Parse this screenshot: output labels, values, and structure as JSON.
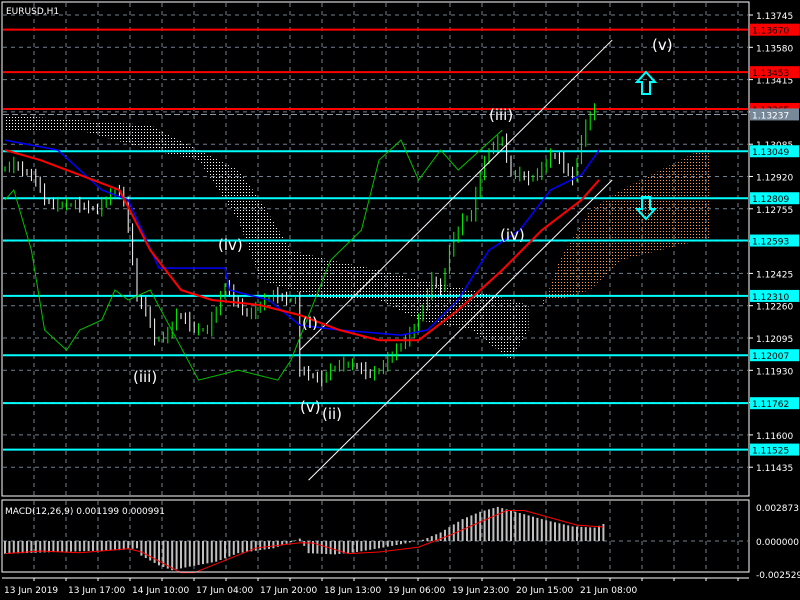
{
  "chart_title": "EURUSD,H1",
  "macd_label": "MACD(12,26,9) 0.001199 0.000991",
  "colors": {
    "background": "#000000",
    "grid": "#708090",
    "up_bar": "#00ff00",
    "down_bar": "#ffffff",
    "red_level": "#ff0000",
    "cyan_level": "#00ffff",
    "ma_red": "#ff0000",
    "ma_blue": "#0000ff",
    "chikou": "#00c000",
    "cloud_bull": "#ff9a40",
    "cloud_bear": "#ffffff",
    "macd_hist": "#c0c0c0",
    "macd_signal": "#ff0000"
  },
  "chart_data": {
    "type": "line",
    "title": "EURUSD,H1",
    "price_axis": {
      "ylim": [
        1.11435,
        1.13745
      ],
      "ticks": [
        "1.13745",
        "1.13580",
        "1.13415",
        "1.13250",
        "1.13085",
        "1.12920",
        "1.12755",
        "1.12590",
        "1.12425",
        "1.12260",
        "1.12095",
        "1.11930",
        "1.11765",
        "1.11600",
        "1.11435"
      ]
    },
    "time_axis": {
      "labels": [
        "13 Jun 2019",
        "13 Jun 17:00",
        "14 Jun 10:00",
        "17 Jun 04:00",
        "17 Jun 20:00",
        "18 Jun 13:00",
        "19 Jun 06:00",
        "19 Jun 23:00",
        "20 Jun 15:00",
        "21 Jun 08:00"
      ]
    },
    "levels_red": [
      "1.13670",
      "1.13453",
      "1.13265"
    ],
    "levels_cyan": [
      "1.13049",
      "1.12809",
      "1.12593",
      "1.12310",
      "1.12007",
      "1.11762",
      "1.11525"
    ],
    "bid_price": "1.13237",
    "price": [
      [
        0,
        1.12953
      ],
      [
        3,
        1.12979
      ],
      [
        8,
        1.12902
      ],
      [
        10,
        1.128
      ],
      [
        12,
        1.12774
      ],
      [
        17,
        1.12774
      ],
      [
        22,
        1.12749
      ],
      [
        26,
        1.12851
      ],
      [
        28,
        1.128
      ],
      [
        30,
        1.12493
      ],
      [
        31,
        1.12289
      ],
      [
        33,
        1.12238
      ],
      [
        35,
        1.12084
      ],
      [
        38,
        1.1211
      ],
      [
        40,
        1.12212
      ],
      [
        42,
        1.12187
      ],
      [
        44,
        1.12136
      ],
      [
        47,
        1.12136
      ],
      [
        49,
        1.12238
      ],
      [
        51,
        1.12365
      ],
      [
        53,
        1.12289
      ],
      [
        56,
        1.12212
      ],
      [
        58,
        1.12238
      ],
      [
        60,
        1.12289
      ],
      [
        62,
        1.12314
      ],
      [
        65,
        1.12289
      ],
      [
        67,
        1.12289
      ],
      [
        68,
        1.11931
      ],
      [
        70,
        1.11905
      ],
      [
        73,
        1.1188
      ],
      [
        75,
        1.11931
      ],
      [
        77,
        1.11957
      ],
      [
        80,
        1.11957
      ],
      [
        82,
        1.11931
      ],
      [
        84,
        1.11905
      ],
      [
        86,
        1.11931
      ],
      [
        89,
        1.12008
      ],
      [
        91,
        1.12059
      ],
      [
        93,
        1.1211
      ],
      [
        95,
        1.12187
      ],
      [
        98,
        1.12391
      ],
      [
        100,
        1.1234
      ],
      [
        102,
        1.12544
      ],
      [
        105,
        1.12698
      ],
      [
        107,
        1.12723
      ],
      [
        109,
        1.12928
      ],
      [
        111,
        1.13055
      ],
      [
        114,
        1.13106
      ],
      [
        116,
        1.12928
      ],
      [
        118,
        1.12928
      ],
      [
        120,
        1.12902
      ],
      [
        123,
        1.12953
      ],
      [
        125,
        1.1303
      ],
      [
        127,
        1.13004
      ],
      [
        130,
        1.12902
      ],
      [
        132,
        1.13106
      ],
      [
        134,
        1.13234
      ],
      [
        135,
        1.1326
      ]
    ],
    "ma_red": [
      [
        0,
        1.13055
      ],
      [
        8,
        1.13004
      ],
      [
        17,
        1.12928
      ],
      [
        26,
        1.12851
      ],
      [
        33,
        1.12544
      ],
      [
        40,
        1.1234
      ],
      [
        47,
        1.12289
      ],
      [
        58,
        1.12263
      ],
      [
        67,
        1.12212
      ],
      [
        76,
        1.12136
      ],
      [
        85,
        1.12084
      ],
      [
        94,
        1.12084
      ],
      [
        103,
        1.12238
      ],
      [
        113,
        1.12442
      ],
      [
        122,
        1.12646
      ],
      [
        131,
        1.128
      ],
      [
        135,
        1.12902
      ]
    ],
    "ma_blue": [
      [
        0,
        1.13106
      ],
      [
        12,
        1.13055
      ],
      [
        22,
        1.12851
      ],
      [
        28,
        1.128
      ],
      [
        35,
        1.12452
      ],
      [
        50,
        1.12452
      ],
      [
        51,
        1.1234
      ],
      [
        60,
        1.12289
      ],
      [
        67,
        1.12161
      ],
      [
        76,
        1.12136
      ],
      [
        90,
        1.1211
      ],
      [
        96,
        1.12136
      ],
      [
        103,
        1.12289
      ],
      [
        110,
        1.12544
      ],
      [
        117,
        1.12646
      ],
      [
        124,
        1.12851
      ],
      [
        131,
        1.12928
      ],
      [
        135,
        1.13055
      ]
    ],
    "chikou": [
      [
        0,
        1.128
      ],
      [
        2,
        1.12851
      ],
      [
        6,
        1.12544
      ],
      [
        9,
        1.12136
      ],
      [
        14,
        1.12033
      ],
      [
        17,
        1.12136
      ],
      [
        22,
        1.12187
      ],
      [
        25,
        1.1234
      ],
      [
        28,
        1.12289
      ],
      [
        33,
        1.1234
      ],
      [
        44,
        1.1188
      ],
      [
        53,
        1.11931
      ],
      [
        62,
        1.1188
      ],
      [
        65,
        1.11982
      ],
      [
        74,
        1.12493
      ],
      [
        81,
        1.12646
      ],
      [
        85,
        1.13004
      ],
      [
        90,
        1.13106
      ],
      [
        94,
        1.12902
      ],
      [
        99,
        1.13055
      ],
      [
        103,
        1.12953
      ],
      [
        108,
        1.13055
      ],
      [
        113,
        1.13157
      ]
    ],
    "cloud_bear": {
      "upper": [
        [
          0,
          1.13234
        ],
        [
          17,
          1.13208
        ],
        [
          33,
          1.13183
        ],
        [
          44,
          1.13055
        ],
        [
          53,
          1.12953
        ],
        [
          58,
          1.128
        ],
        [
          65,
          1.12544
        ],
        [
          74,
          1.12493
        ],
        [
          85,
          1.12442
        ],
        [
          94,
          1.12391
        ],
        [
          106,
          1.1234
        ],
        [
          115,
          1.12289
        ],
        [
          119,
          1.12263
        ]
      ],
      "lower": [
        [
          0,
          1.13157
        ],
        [
          17,
          1.13157
        ],
        [
          33,
          1.13055
        ],
        [
          44,
          1.13004
        ],
        [
          53,
          1.12698
        ],
        [
          58,
          1.12391
        ],
        [
          65,
          1.1234
        ],
        [
          74,
          1.12289
        ],
        [
          85,
          1.12289
        ],
        [
          94,
          1.12187
        ],
        [
          106,
          1.12136
        ],
        [
          115,
          1.11982
        ],
        [
          119,
          1.12136
        ]
      ]
    },
    "cloud_bull": {
      "upper": [
        [
          122,
          1.12238
        ],
        [
          126,
          1.12493
        ],
        [
          133,
          1.12749
        ],
        [
          140,
          1.12851
        ],
        [
          149,
          1.12953
        ],
        [
          158,
          1.13055
        ],
        [
          160,
          1.13055
        ]
      ],
      "lower": [
        [
          122,
          1.12289
        ],
        [
          126,
          1.12289
        ],
        [
          133,
          1.1234
        ],
        [
          140,
          1.12493
        ],
        [
          149,
          1.12544
        ],
        [
          158,
          1.12595
        ],
        [
          160,
          1.12595
        ]
      ]
    },
    "channel": [
      {
        "from": [
          67,
          1.12033
        ],
        "to": [
          138,
          1.13617
        ]
      },
      {
        "from": [
          69,
          1.11369
        ],
        "to": [
          138,
          1.12902
        ]
      }
    ],
    "wave_labels": [
      "(v)",
      "(iii)",
      "(iv)",
      "(iii)",
      "(i)",
      "(v)",
      "(ii)",
      "(iv)"
    ],
    "arrows": [
      "up",
      "down"
    ],
    "macd": {
      "label": "MACD(12,26,9)",
      "value": 0.001199,
      "signal_value": 0.000991,
      "ylim": [
        -0.002529,
        0.002873
      ],
      "ticks": [
        "0.002873",
        "0.000000",
        "-0.002529"
      ],
      "histogram": [
        [
          0,
          -0.00105
        ],
        [
          12,
          -0.0009
        ],
        [
          26,
          -0.00075
        ],
        [
          30,
          -0.0006
        ],
        [
          31,
          -0.0012
        ],
        [
          35,
          -0.002
        ],
        [
          38,
          -0.0024
        ],
        [
          42,
          -0.0021
        ],
        [
          48,
          -0.0017
        ],
        [
          53,
          -0.001
        ],
        [
          61,
          -0.0006
        ],
        [
          65,
          -0.0001
        ],
        [
          67,
          0.0002
        ],
        [
          69,
          -0.001
        ],
        [
          75,
          -0.0011
        ],
        [
          80,
          -0.0009
        ],
        [
          85,
          -0.0006
        ],
        [
          91,
          -0.0002
        ],
        [
          95,
          0.0001
        ],
        [
          99,
          0.0007
        ],
        [
          104,
          0.0018
        ],
        [
          108,
          0.0024
        ],
        [
          112,
          0.0028
        ],
        [
          118,
          0.0022
        ],
        [
          123,
          0.0017
        ],
        [
          129,
          0.0012
        ],
        [
          134,
          0.0011
        ],
        [
          136,
          0.0014
        ]
      ],
      "signal": [
        [
          0,
          -0.00104
        ],
        [
          8,
          -0.00082
        ],
        [
          17,
          -0.00096
        ],
        [
          28,
          -0.00063
        ],
        [
          31,
          -0.0009
        ],
        [
          40,
          -0.0026
        ],
        [
          43,
          -0.0026
        ],
        [
          57,
          -0.00058
        ],
        [
          67,
          -0.00014
        ],
        [
          70,
          -0.00016
        ],
        [
          78,
          -0.00104
        ],
        [
          85,
          -0.0009
        ],
        [
          94,
          -0.0005
        ],
        [
          101,
          0.00047
        ],
        [
          114,
          0.0025
        ],
        [
          118,
          0.0025
        ],
        [
          130,
          0.0013
        ],
        [
          136,
          0.00115
        ]
      ]
    }
  }
}
